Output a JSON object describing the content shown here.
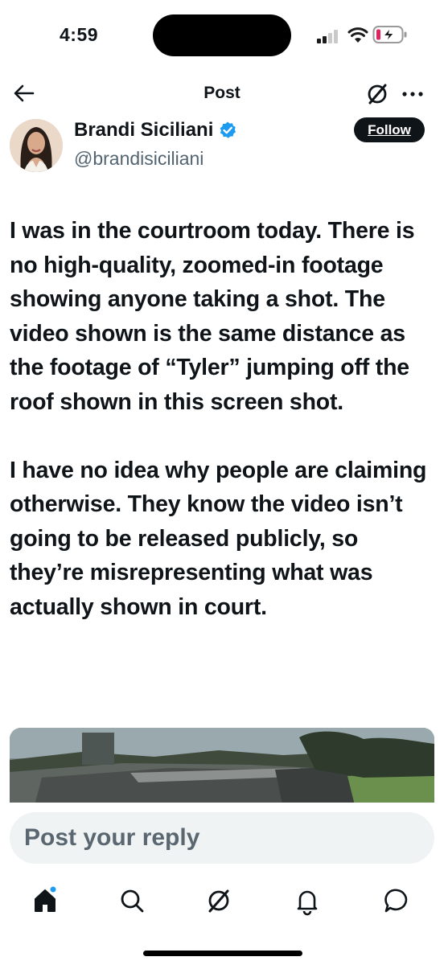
{
  "status_bar": {
    "time": "4:59",
    "battery_charging": true
  },
  "header": {
    "title": "Post",
    "icons": [
      "back-arrow-icon",
      "grok-icon",
      "more-icon"
    ]
  },
  "author": {
    "display_name": "Brandi Siciliani",
    "handle": "@brandisiciliani",
    "verified": true,
    "follow_label": "Follow"
  },
  "tweet": {
    "paragraphs": [
      "I was in the courtroom today. There is no high-quality, zoomed-in footage showing anyone taking a shot. The video shown is the same distance as the footage of “Tyler” jumping off the roof shown in this screen shot.",
      "I have no idea why people are claiming otherwise. They know the video isn’t going to be released publicly, so they’re misrepresenting what was actually shown in court."
    ]
  },
  "reply": {
    "placeholder": "Post your reply"
  },
  "tab_bar": {
    "tabs": [
      "home-icon",
      "search-icon",
      "grok-icon",
      "notifications-icon",
      "messages-icon"
    ],
    "home_has_indicator": true
  },
  "colors": {
    "text": "#0f1419",
    "secondary": "#536471",
    "verified": "#1d9bf0",
    "reply_bg": "#eff3f4",
    "battery_alert": "#e0245e"
  }
}
